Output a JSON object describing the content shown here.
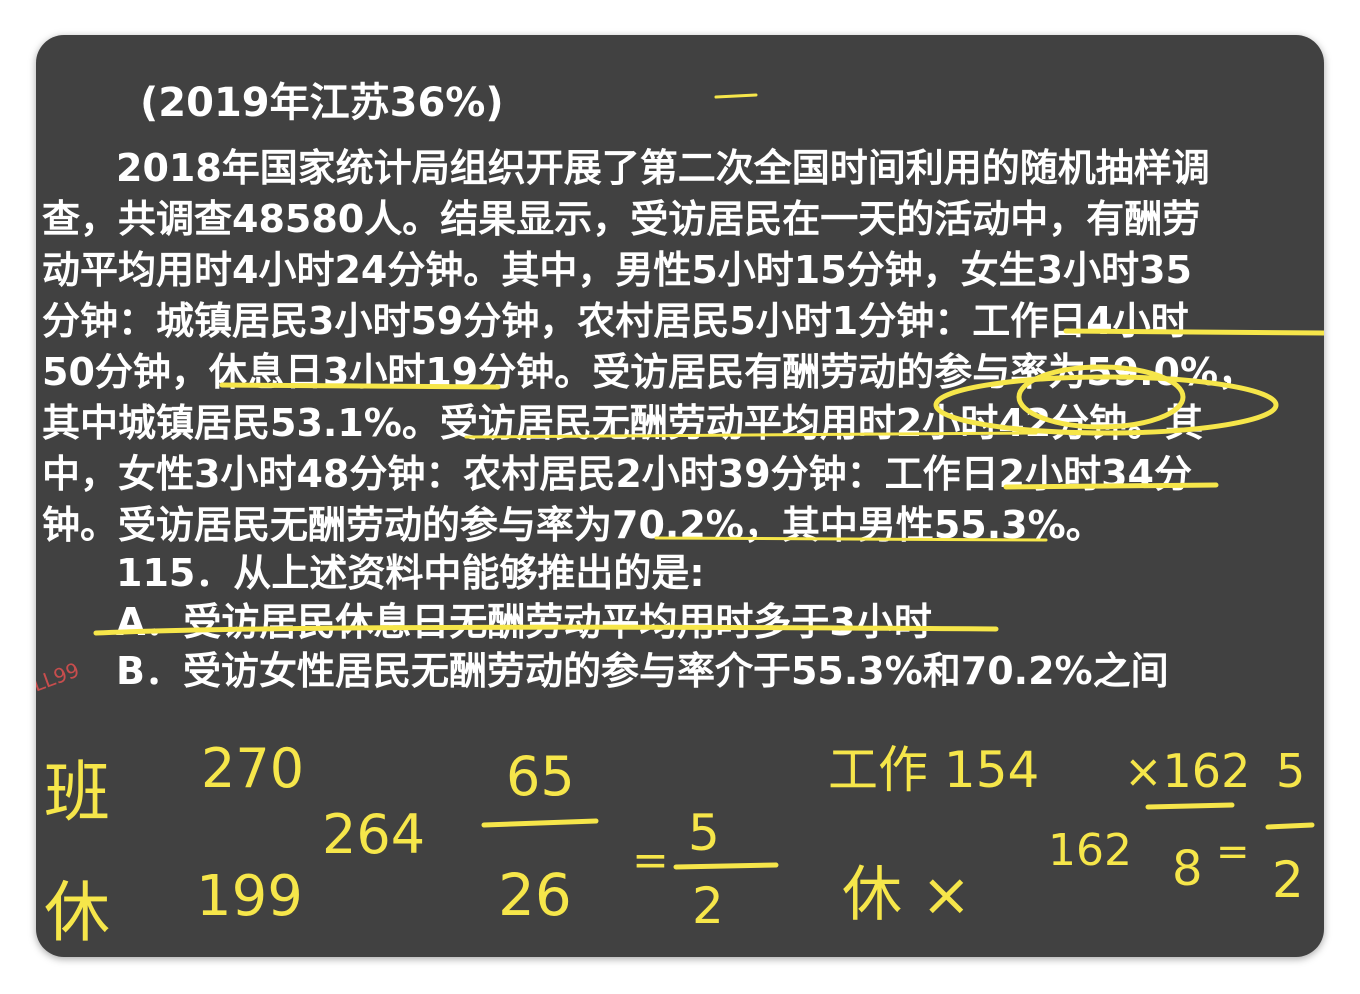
{
  "slide": {
    "title": "(2019年江苏36%)",
    "lines": [
      "2018年国家统计局组织开展了第二次全国时间利用的随机抽样调",
      "查，共调查48580人。结果显示，受访居民在一天的活动中，有酬劳",
      "动平均用时4小时24分钟。其中，男性5小时15分钟，女生3小时35",
      "分钟：城镇居民3小时59分钟，农村居民5小时1分钟：工作日4小时",
      "50分钟，休息日3小时19分钟。受访居民有酬劳动的参与率为59.0%，",
      "其中城镇居民53.1%。受访居民无酬劳动平均用时2小时42分钟。其",
      "中，女性3小时48分钟：农村居民2小时39分钟：工作日2小时34分",
      "钟。受访居民无酬劳动的参与率为70.2%，其中男性55.3%。"
    ],
    "question": "115．从上述资料中能够推出的是:",
    "option_a": "A．受访居民休息日无酬劳动平均用时多于3小时",
    "option_b": "B．受访女性居民无酬劳动的参与率介于55.3%和70.2%之间",
    "watermark": "LL99"
  },
  "colors": {
    "board": "#414141",
    "text": "#ffffff",
    "ink": "#f6e64a",
    "watermark": "#e05050"
  },
  "annotations": {
    "handwriting_1": "班",
    "handwriting_2": "270",
    "handwriting_3": "休",
    "handwriting_4": "199",
    "handwriting_5": "264",
    "handwriting_6": "65",
    "handwriting_7": "26",
    "handwriting_8": "=",
    "handwriting_9": "5",
    "handwriting_10": "2",
    "handwriting_11": "工作 154",
    "handwriting_12": "休 ×",
    "handwriting_13": "162",
    "handwriting_14": "×162",
    "handwriting_15": "8",
    "handwriting_16": "=",
    "handwriting_17": "5",
    "handwriting_18": "2"
  }
}
